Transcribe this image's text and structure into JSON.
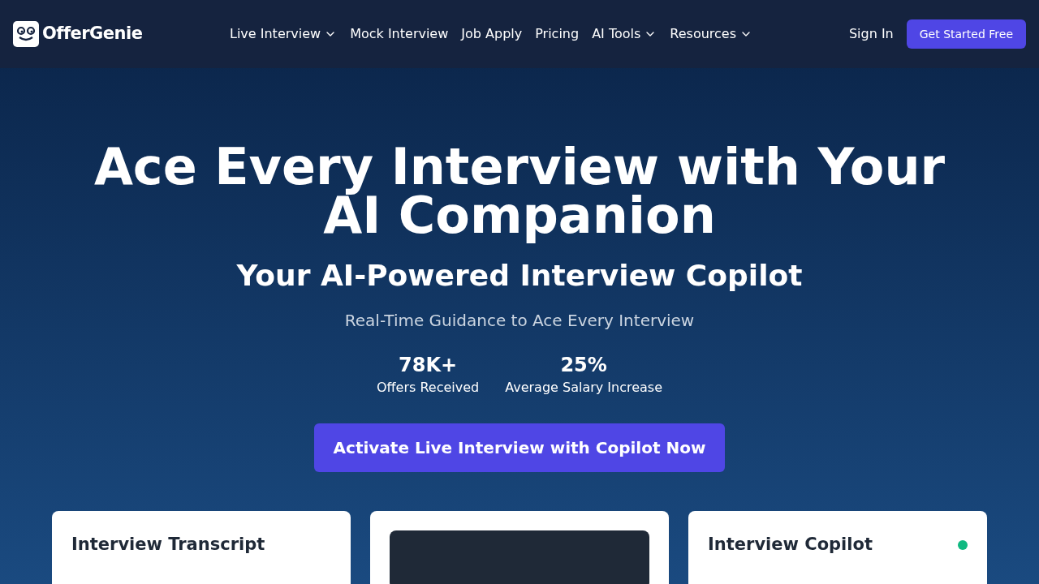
{
  "brand": {
    "name": "OfferGenie"
  },
  "nav": [
    {
      "label": "Live Interview",
      "dropdown": true
    },
    {
      "label": "Mock Interview",
      "dropdown": false
    },
    {
      "label": "Job Apply",
      "dropdown": false
    },
    {
      "label": "Pricing",
      "dropdown": false
    },
    {
      "label": "AI Tools",
      "dropdown": true
    },
    {
      "label": "Resources",
      "dropdown": true
    }
  ],
  "sign_in": "Sign In",
  "get_started": "Get Started Free",
  "hero": {
    "title": "Ace Every Interview with Your AI Companion",
    "subtitle": "Your AI-Powered Interview Copilot",
    "tagline": "Real-Time Guidance to Ace Every Interview",
    "stats": [
      {
        "value": "78K+",
        "label": "Offers Received"
      },
      {
        "value": "25%",
        "label": "Average Salary Increase"
      }
    ],
    "cta": "Activate Live Interview with Copilot Now"
  },
  "cards": [
    {
      "kind": "text",
      "title": "Interview Transcript"
    },
    {
      "kind": "video"
    },
    {
      "kind": "text",
      "title": "Interview Copilot",
      "live": true
    }
  ]
}
